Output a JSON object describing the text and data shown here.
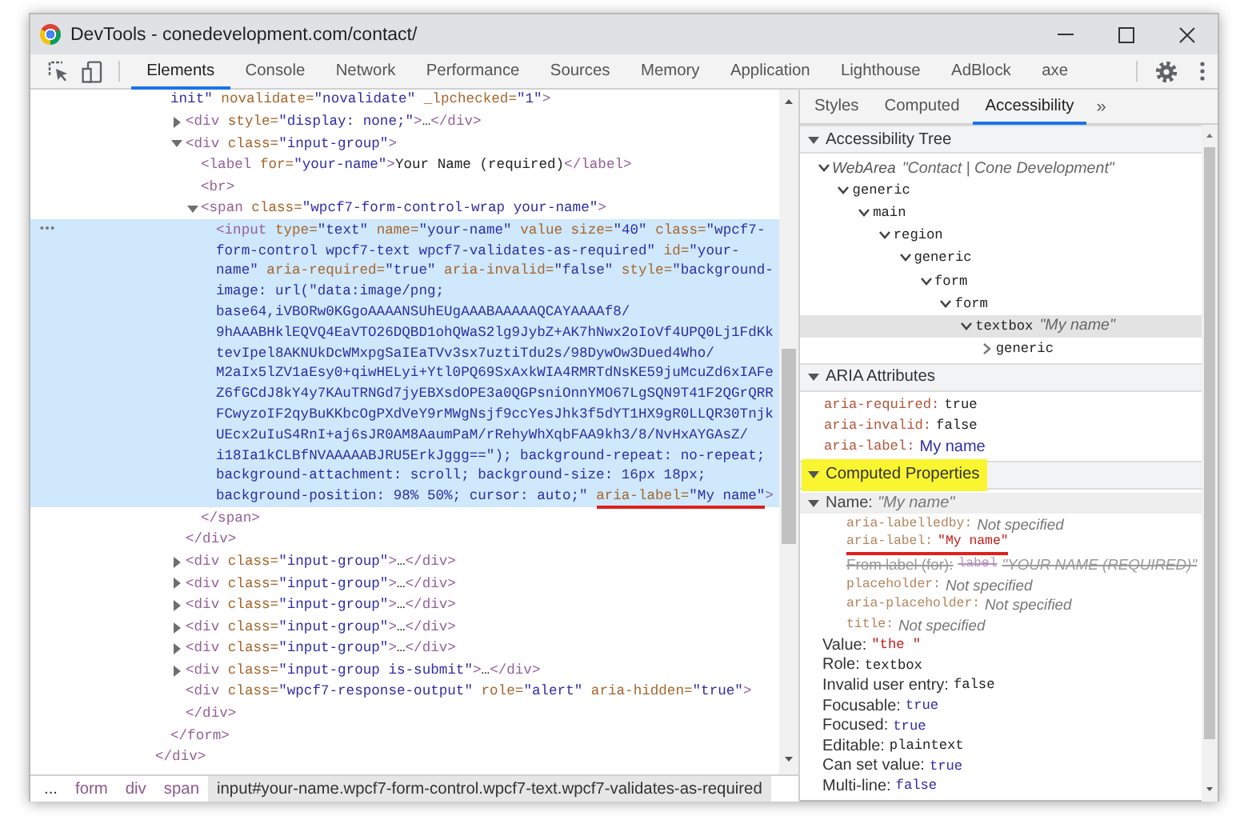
{
  "window": {
    "title": "DevTools - conedevelopment.com/contact/"
  },
  "toolbar": {
    "tabs": [
      {
        "label": "Elements",
        "selected": true
      },
      {
        "label": "Console",
        "selected": false
      },
      {
        "label": "Network",
        "selected": false
      },
      {
        "label": "Performance",
        "selected": false
      },
      {
        "label": "Sources",
        "selected": false
      },
      {
        "label": "Memory",
        "selected": false
      },
      {
        "label": "Application",
        "selected": false
      },
      {
        "label": "Lighthouse",
        "selected": false
      },
      {
        "label": "AdBlock",
        "selected": false
      },
      {
        "label": "axe",
        "selected": false
      }
    ]
  },
  "elements_panel": {
    "dom_tree": [
      {
        "children": [
          {
            "lines": [
              [
                {
                  "kind": "value",
                  "text": "init\""
                },
                {
                  "kind": "attr",
                  "text": " novalidate="
                },
                {
                  "kind": "value",
                  "text": "\"novalidate\""
                },
                {
                  "kind": "attr",
                  "text": " _lpchecked="
                },
                {
                  "kind": "value",
                  "text": "\"1\""
                },
                {
                  "kind": "tag",
                  "text": ">"
                }
              ]
            ],
            "selected": false,
            "children": [
              {
                "expanded": false,
                "selected": false,
                "lines": [
                  [
                    {
                      "kind": "tag",
                      "text": "<div"
                    },
                    {
                      "kind": "attr",
                      "text": " style="
                    },
                    {
                      "kind": "value",
                      "text": "\"display: none;\""
                    },
                    {
                      "kind": "tag",
                      "text": ">"
                    },
                    {
                      "kind": "text",
                      "text": "…"
                    },
                    {
                      "kind": "tag",
                      "text": "</div>"
                    }
                  ]
                ]
              },
              {
                "expanded": true,
                "selected": false,
                "lines": [
                  [
                    {
                      "kind": "tag",
                      "text": "<div"
                    },
                    {
                      "kind": "attr",
                      "text": " class="
                    },
                    {
                      "kind": "value",
                      "text": "\"input-group\""
                    },
                    {
                      "kind": "tag",
                      "text": ">"
                    }
                  ]
                ],
                "children": [
                  {
                    "selected": false,
                    "lines": [
                      [
                        {
                          "kind": "tag",
                          "text": "<label"
                        },
                        {
                          "kind": "attr",
                          "text": " for="
                        },
                        {
                          "kind": "value",
                          "text": "\"your-name\""
                        },
                        {
                          "kind": "tag",
                          "text": ">"
                        },
                        {
                          "kind": "text",
                          "text": "Your Name (required)"
                        },
                        {
                          "kind": "tag",
                          "text": "</label>"
                        }
                      ]
                    ]
                  },
                  {
                    "selected": false,
                    "lines": [
                      [
                        {
                          "kind": "tag",
                          "text": "<br>"
                        }
                      ]
                    ]
                  },
                  {
                    "expanded": true,
                    "selected": false,
                    "lines": [
                      [
                        {
                          "kind": "tag",
                          "text": "<span"
                        },
                        {
                          "kind": "attr",
                          "text": " class="
                        },
                        {
                          "kind": "value",
                          "text": "\"wpcf7-form-control-wrap your-name\""
                        },
                        {
                          "kind": "tag",
                          "text": ">"
                        }
                      ]
                    ],
                    "children": [
                      {
                        "selected": true,
                        "lines": [
                          [
                            {
                              "kind": "tag",
                              "text": "<input"
                            },
                            {
                              "kind": "attr",
                              "text": " type="
                            },
                            {
                              "kind": "value",
                              "text": "\"text\""
                            },
                            {
                              "kind": "attr",
                              "text": " name="
                            },
                            {
                              "kind": "value",
                              "text": "\"your-name\""
                            },
                            {
                              "kind": "attr",
                              "text": " value size="
                            },
                            {
                              "kind": "value",
                              "text": "\"40\""
                            },
                            {
                              "kind": "attr",
                              "text": " class="
                            },
                            {
                              "kind": "value",
                              "text": "\"wpcf7-"
                            }
                          ],
                          [
                            {
                              "kind": "value",
                              "text": "form-control wpcf7-text wpcf7-validates-as-required\""
                            },
                            {
                              "kind": "attr",
                              "text": " id="
                            },
                            {
                              "kind": "value",
                              "text": "\"your-"
                            }
                          ],
                          [
                            {
                              "kind": "value",
                              "text": "name\""
                            },
                            {
                              "kind": "attr",
                              "text": " aria-required="
                            },
                            {
                              "kind": "value",
                              "text": "\"true\""
                            },
                            {
                              "kind": "attr",
                              "text": " aria-invalid="
                            },
                            {
                              "kind": "value",
                              "text": "\"false\""
                            },
                            {
                              "kind": "attr",
                              "text": " style="
                            },
                            {
                              "kind": "value",
                              "text": "\"background-"
                            }
                          ],
                          [
                            {
                              "kind": "value",
                              "text": "image: url(\"data:image/png;"
                            }
                          ],
                          [
                            {
                              "kind": "value",
                              "text": "base64,iVBORw0KGgoAAAANSUhEUgAAABAAAAAQCAYAAAAf8/"
                            }
                          ],
                          [
                            {
                              "kind": "value",
                              "text": "9hAAABHklEQVQ4EaVTO26DQBD1ohQWaS2lg9JybZ+AK7hNwx2oIoVf4UPQ0Lj1FdKk"
                            }
                          ],
                          [
                            {
                              "kind": "value",
                              "text": "tevIpel8AKNUkDcWMxpgSaIEaTVv3sx7uztiTdu2s/98DywOw3Dued4Who/"
                            }
                          ],
                          [
                            {
                              "kind": "value",
                              "text": "M2aIx5lZV1aEsy0+qiwHELyi+Ytl0PQ69SxAxkWIA4RMRTdNsKE59juMcuZd6xIAFe"
                            }
                          ],
                          [
                            {
                              "kind": "value",
                              "text": "Z6fGCdJ8kY4y7KAuTRNGd7jyEBXsdOPE3a0QGPsniOnnYMO67LgSQN9T41F2QGrQRR"
                            }
                          ],
                          [
                            {
                              "kind": "value",
                              "text": "FCwyzoIF2qyBuKKbcOgPXdVeY9rMWgNsjf9ccYesJhk3f5dYT1HX9gR0LLQR30Tnjk"
                            }
                          ],
                          [
                            {
                              "kind": "value",
                              "text": "UEcx2uIuS4RnI+aj6sJR0AM8AaumPaM/rRehyWhXqbFAA9kh3/8/NvHxAYGAsZ/"
                            }
                          ],
                          [
                            {
                              "kind": "value",
                              "text": "i18Ia1kCLBfNVAAAAABJRU5ErkJggg==\"); background-repeat: no-repeat;"
                            }
                          ],
                          [
                            {
                              "kind": "value",
                              "text": "background-attachment: scroll; background-size: 16px 18px;"
                            }
                          ],
                          [
                            {
                              "kind": "value",
                              "text": "background-position: 98% 50%; cursor: auto;\" "
                            },
                            {
                              "kind": "attr",
                              "text": "aria-label=",
                              "underlined": true
                            },
                            {
                              "kind": "value",
                              "text": "\"My name\"",
                              "underlined": true
                            },
                            {
                              "kind": "tag",
                              "text": ">"
                            }
                          ]
                        ]
                      }
                    ],
                    "close": [
                      {
                        "kind": "tag",
                        "text": "</span>"
                      }
                    ]
                  }
                ],
                "close": [
                  {
                    "kind": "tag",
                    "text": "</div>"
                  }
                ]
              },
              {
                "expanded": false,
                "selected": false,
                "lines": [
                  [
                    {
                      "kind": "tag",
                      "text": "<div"
                    },
                    {
                      "kind": "attr",
                      "text": " class="
                    },
                    {
                      "kind": "value",
                      "text": "\"input-group\""
                    },
                    {
                      "kind": "tag",
                      "text": ">"
                    },
                    {
                      "kind": "text",
                      "text": "…"
                    },
                    {
                      "kind": "tag",
                      "text": "</div>"
                    }
                  ]
                ]
              },
              {
                "expanded": false,
                "selected": false,
                "lines": [
                  [
                    {
                      "kind": "tag",
                      "text": "<div"
                    },
                    {
                      "kind": "attr",
                      "text": " class="
                    },
                    {
                      "kind": "value",
                      "text": "\"input-group\""
                    },
                    {
                      "kind": "tag",
                      "text": ">"
                    },
                    {
                      "kind": "text",
                      "text": "…"
                    },
                    {
                      "kind": "tag",
                      "text": "</div>"
                    }
                  ]
                ]
              },
              {
                "expanded": false,
                "selected": false,
                "lines": [
                  [
                    {
                      "kind": "tag",
                      "text": "<div"
                    },
                    {
                      "kind": "attr",
                      "text": " class="
                    },
                    {
                      "kind": "value",
                      "text": "\"input-group\""
                    },
                    {
                      "kind": "tag",
                      "text": ">"
                    },
                    {
                      "kind": "text",
                      "text": "…"
                    },
                    {
                      "kind": "tag",
                      "text": "</div>"
                    }
                  ]
                ]
              },
              {
                "expanded": false,
                "selected": false,
                "lines": [
                  [
                    {
                      "kind": "tag",
                      "text": "<div"
                    },
                    {
                      "kind": "attr",
                      "text": " class="
                    },
                    {
                      "kind": "value",
                      "text": "\"input-group\""
                    },
                    {
                      "kind": "tag",
                      "text": ">"
                    },
                    {
                      "kind": "text",
                      "text": "…"
                    },
                    {
                      "kind": "tag",
                      "text": "</div>"
                    }
                  ]
                ]
              },
              {
                "expanded": false,
                "selected": false,
                "lines": [
                  [
                    {
                      "kind": "tag",
                      "text": "<div"
                    },
                    {
                      "kind": "attr",
                      "text": " class="
                    },
                    {
                      "kind": "value",
                      "text": "\"input-group\""
                    },
                    {
                      "kind": "tag",
                      "text": ">"
                    },
                    {
                      "kind": "text",
                      "text": "…"
                    },
                    {
                      "kind": "tag",
                      "text": "</div>"
                    }
                  ]
                ]
              },
              {
                "expanded": false,
                "selected": false,
                "lines": [
                  [
                    {
                      "kind": "tag",
                      "text": "<div"
                    },
                    {
                      "kind": "attr",
                      "text": " class="
                    },
                    {
                      "kind": "value",
                      "text": "\"input-group is-submit\""
                    },
                    {
                      "kind": "tag",
                      "text": ">"
                    },
                    {
                      "kind": "text",
                      "text": "…"
                    },
                    {
                      "kind": "tag",
                      "text": "</div>"
                    }
                  ]
                ]
              },
              {
                "selected": false,
                "lines": [
                  [
                    {
                      "kind": "tag",
                      "text": "<div"
                    },
                    {
                      "kind": "attr",
                      "text": " class="
                    },
                    {
                      "kind": "value",
                      "text": "\"wpcf7-response-output\""
                    },
                    {
                      "kind": "attr",
                      "text": " role="
                    },
                    {
                      "kind": "value",
                      "text": "\"alert\""
                    },
                    {
                      "kind": "attr",
                      "text": " aria-hidden="
                    },
                    {
                      "kind": "value",
                      "text": "\"true\""
                    },
                    {
                      "kind": "tag",
                      "text": ">"
                    }
                  ]
                ],
                "close": [
                  {
                    "kind": "tag",
                    "text": "</div>"
                  }
                ]
              }
            ],
            "close": [
              {
                "kind": "tag",
                "text": "</form>"
              }
            ]
          }
        ],
        "close": [
          {
            "kind": "tag",
            "text": "</div>"
          }
        ]
      }
    ],
    "breadcrumbs": [
      {
        "label": "...",
        "selected": false
      },
      {
        "label": "form",
        "selected": false
      },
      {
        "label": "div",
        "selected": false
      },
      {
        "label": "span",
        "selected": false
      },
      {
        "label": "input#your-name.wpcf7-form-control.wpcf7-text.wpcf7-validates-as-required",
        "selected": true
      }
    ]
  },
  "sidebar": {
    "tabs": [
      {
        "label": "Styles",
        "selected": false
      },
      {
        "label": "Computed",
        "selected": false
      },
      {
        "label": "Accessibility",
        "selected": true
      }
    ],
    "overflow": "»",
    "sections": [
      {
        "kind": "tree",
        "title": "Accessibility Tree",
        "expanded": true,
        "highlighted": false,
        "nodes": [
          {
            "role": "WebArea",
            "name": "\"Contact | Cone Development\"",
            "expanded": true,
            "selected": false,
            "children": [
              {
                "role": "generic",
                "expanded": true,
                "selected": false,
                "children": [
                  {
                    "role": "main",
                    "expanded": true,
                    "selected": false,
                    "children": [
                      {
                        "role": "region",
                        "expanded": true,
                        "selected": false,
                        "children": [
                          {
                            "role": "generic",
                            "expanded": true,
                            "selected": false,
                            "children": [
                              {
                                "role": "form",
                                "expanded": true,
                                "selected": false,
                                "children": [
                                  {
                                    "role": "form",
                                    "expanded": true,
                                    "selected": false,
                                    "children": [
                                      {
                                        "role": "textbox",
                                        "name": "\"My name\"",
                                        "expanded": true,
                                        "selected": true,
                                        "children": [
                                          {
                                            "role": "generic",
                                            "expanded": false,
                                            "selected": false
                                          }
                                        ]
                                      }
                                    ]
                                  }
                                ]
                              }
                            ]
                          }
                        ]
                      }
                    ]
                  }
                ]
              }
            ]
          }
        ]
      },
      {
        "kind": "attributes",
        "title": "ARIA Attributes",
        "expanded": true,
        "highlighted": false,
        "rows": [
          {
            "name": "aria-required:",
            "value": "true",
            "kind": "keyword"
          },
          {
            "name": "aria-invalid:",
            "value": "false",
            "kind": "keyword"
          },
          {
            "name": "aria-label:",
            "value": "My name",
            "kind": "string"
          }
        ]
      },
      {
        "kind": "computed",
        "title": "Computed Properties",
        "expanded": true,
        "highlighted": true,
        "name_row": {
          "label": "Name:",
          "value": "\"My name\"",
          "expanded": true,
          "sources": [
            {
              "kind": "missing",
              "name": "aria-labelledby:",
              "value": "Not specified",
              "superseded": false,
              "underlined": false
            },
            {
              "kind": "string",
              "name": "aria-label:",
              "value": "\"My name\"",
              "superseded": false,
              "underlined": true
            },
            {
              "kind": "node",
              "name": "From label (for):",
              "tag": "label",
              "value": "\"YOUR NAME (REQUIRED)\"",
              "superseded": true,
              "underlined": false
            },
            {
              "kind": "missing",
              "name": "placeholder:",
              "value": "Not specified",
              "superseded": false,
              "underlined": false
            },
            {
              "kind": "missing",
              "name": "aria-placeholder:",
              "value": "Not specified",
              "superseded": false,
              "underlined": false
            },
            {
              "kind": "missing",
              "name": "title:",
              "value": "Not specified",
              "superseded": false,
              "underlined": false
            }
          ]
        },
        "properties": [
          {
            "label": "Value:",
            "value": "\"the \"",
            "kind": "string"
          },
          {
            "label": "Role:",
            "value": "textbox",
            "kind": "text"
          },
          {
            "label": "Invalid user entry:",
            "value": "false",
            "kind": "text"
          },
          {
            "label": "Focusable:",
            "value": "true",
            "kind": "boolean"
          },
          {
            "label": "Focused:",
            "value": "true",
            "kind": "boolean"
          },
          {
            "label": "Editable:",
            "value": "plaintext",
            "kind": "text"
          },
          {
            "label": "Can set value:",
            "value": "true",
            "kind": "boolean"
          },
          {
            "label": "Multi-line:",
            "value": "false",
            "kind": "boolean"
          }
        ]
      }
    ]
  }
}
